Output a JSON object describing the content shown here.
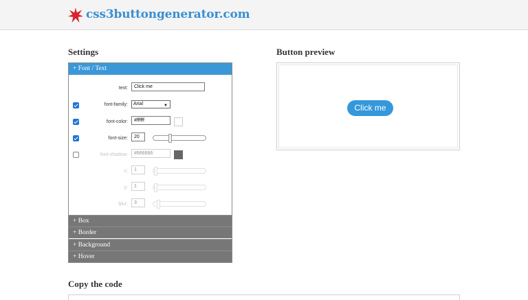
{
  "site": {
    "name": "css3buttongenerator.com"
  },
  "settings": {
    "title": "Settings",
    "sections": {
      "font_text": "+ Font / Text",
      "box": "+ Box",
      "border": "+ Border",
      "background": "+ Background",
      "hover": "+ Hover"
    },
    "fields": {
      "text": {
        "label": "text:",
        "value": "Click me"
      },
      "font_family": {
        "label": "font-family:",
        "value": "Arial",
        "checked": true
      },
      "font_color": {
        "label": "font-color:",
        "value": "#ffffff",
        "checked": true,
        "swatch": "#ffffff"
      },
      "font_size": {
        "label": "font-size:",
        "value": "20",
        "checked": true
      },
      "font_shadow": {
        "label": "font-shadow:",
        "value": "#666666",
        "checked": false,
        "swatch": "#666666"
      },
      "shadow_x": {
        "label": "x:",
        "value": "1"
      },
      "shadow_y": {
        "label": "y:",
        "value": "1"
      },
      "shadow_blur": {
        "label": "blur:",
        "value": "3"
      }
    }
  },
  "preview": {
    "title": "Button preview",
    "button_label": "Click me",
    "button_color": "#3498db"
  },
  "code": {
    "title": "Copy the code"
  },
  "colors": {
    "accent": "#3b98d7",
    "logo": "#3a8fd2",
    "star": "#d9232d",
    "closed_header": "#777777"
  }
}
